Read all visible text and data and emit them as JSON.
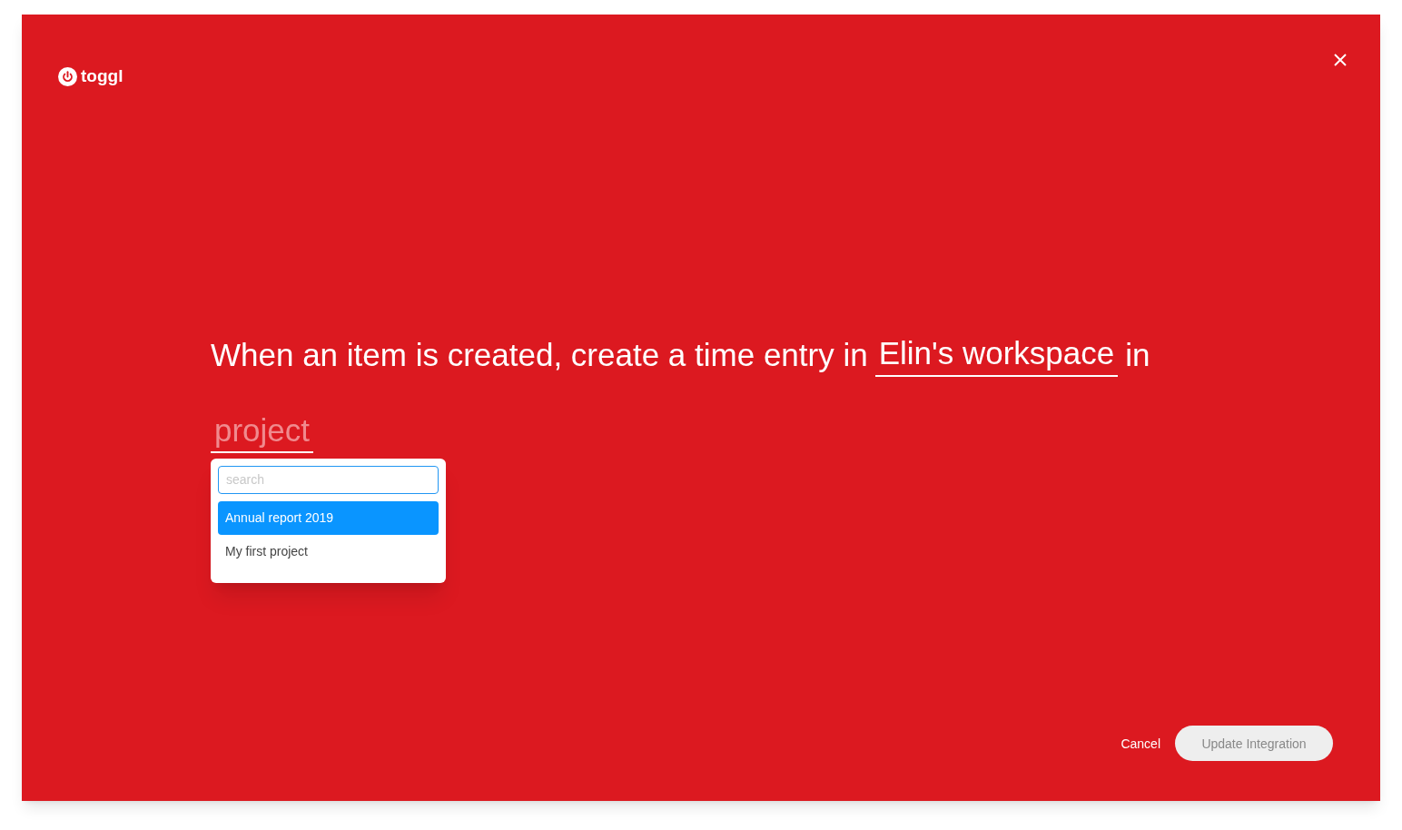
{
  "logo": {
    "text": "toggl"
  },
  "sentence": {
    "lead": "When an item is created, create a time entry in",
    "workspace": "Elin's workspace",
    "connector": "in",
    "project_placeholder": "project"
  },
  "dropdown": {
    "search_placeholder": "search",
    "options": [
      {
        "label": "Annual report 2019",
        "selected": true
      },
      {
        "label": "My first project",
        "selected": false
      }
    ]
  },
  "buttons": {
    "cancel": "Cancel",
    "submit": {
      "label": "Update Integration",
      "disabled": true
    }
  }
}
